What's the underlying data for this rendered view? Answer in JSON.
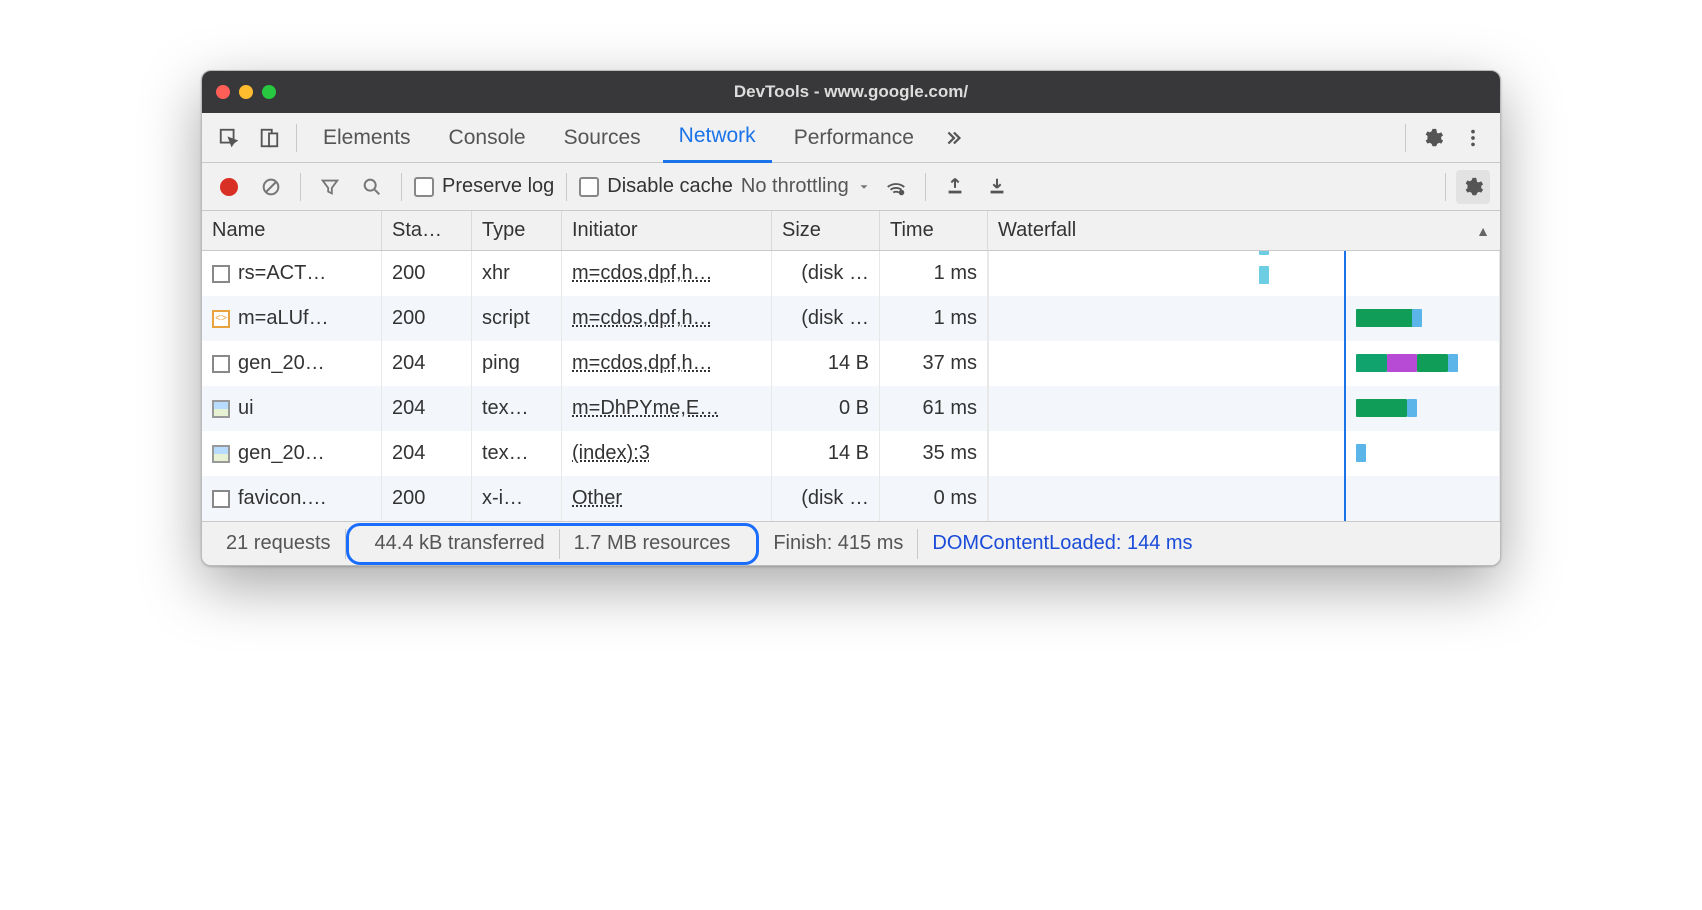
{
  "window": {
    "title": "DevTools - www.google.com/"
  },
  "tabs": [
    "Elements",
    "Console",
    "Sources",
    "Network",
    "Performance"
  ],
  "activeTab": "Network",
  "toolbar": {
    "preserveLog": "Preserve log",
    "disableCache": "Disable cache",
    "throttling": "No throttling"
  },
  "columns": {
    "name": "Name",
    "status": "Sta…",
    "type": "Type",
    "initiator": "Initiator",
    "size": "Size",
    "time": "Time",
    "waterfall": "Waterfall"
  },
  "rows": [
    {
      "icon": "doc",
      "name": "rs=ACT…",
      "status": "200",
      "type": "xhr",
      "initiator": "m=cdos,dpf,h…",
      "size": "(disk …",
      "time": "1 ms",
      "wf": [
        {
          "l": 53,
          "w": 2,
          "c": "#6ccde3",
          "t": -27
        },
        {
          "l": 53,
          "w": 2,
          "c": "#6ccde3",
          "t": 2
        }
      ]
    },
    {
      "icon": "js",
      "name": "m=aLUf…",
      "status": "200",
      "type": "script",
      "initiator": "m=cdos,dpf,h…",
      "size": "(disk …",
      "time": "1 ms",
      "wf": [
        {
          "l": 72,
          "w": 12,
          "c": "#0f9d58",
          "t": 0
        },
        {
          "l": 83,
          "w": 2,
          "c": "#5bb5e8",
          "t": 0
        }
      ]
    },
    {
      "icon": "doc",
      "name": "gen_20…",
      "status": "204",
      "type": "ping",
      "initiator": "m=cdos,dpf,h…",
      "size": "14 B",
      "time": "37 ms",
      "wf": [
        {
          "l": 72,
          "w": 6,
          "c": "#10a36e",
          "t": 0
        },
        {
          "l": 78,
          "w": 6,
          "c": "#b84bd6",
          "t": 0
        },
        {
          "l": 84,
          "w": 6,
          "c": "#0f9d58",
          "t": 0
        },
        {
          "l": 90,
          "w": 2,
          "c": "#5bb5e8",
          "t": 0
        }
      ]
    },
    {
      "icon": "img",
      "name": "ui",
      "status": "204",
      "type": "tex…",
      "initiator": "m=DhPYme,E…",
      "size": "0 B",
      "time": "61 ms",
      "wf": [
        {
          "l": 72,
          "w": 10,
          "c": "#0f9d58",
          "t": 0
        },
        {
          "l": 82,
          "w": 2,
          "c": "#5bb5e8",
          "t": 0
        }
      ]
    },
    {
      "icon": "img",
      "name": "gen_20…",
      "status": "204",
      "type": "tex…",
      "initiator": "(index):3",
      "size": "14 B",
      "time": "35 ms",
      "wf": [
        {
          "l": 72,
          "w": 2,
          "c": "#5bb5e8",
          "t": 0
        }
      ]
    },
    {
      "icon": "doc",
      "name": "favicon.…",
      "status": "200",
      "type": "x-i…",
      "initiator": "Other",
      "size": "(disk …",
      "time": "0 ms",
      "wf": []
    }
  ],
  "status": {
    "requests": "21 requests",
    "transferred": "44.4 kB transferred",
    "resources": "1.7 MB resources",
    "finish": "Finish: 415 ms",
    "domLoaded": "DOMContentLoaded: 144 ms"
  },
  "waterfall_lines": {
    "blue_pct": 30,
    "red_pct": 70
  }
}
